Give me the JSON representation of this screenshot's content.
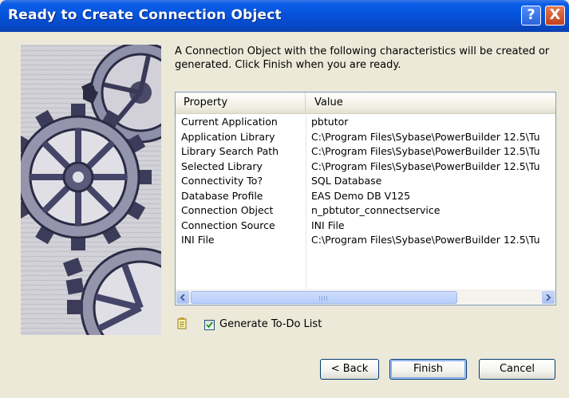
{
  "window": {
    "title": "Ready to Create Connection Object",
    "help_button": "?",
    "close_button": "X"
  },
  "description": "A Connection Object with the following characteristics will be created or generated.  Click Finish when you are ready.",
  "table": {
    "columns": [
      "Property",
      "Value"
    ],
    "rows": [
      {
        "property": "Current Application",
        "value": "pbtutor"
      },
      {
        "property": "Application Library",
        "value": "C:\\Program Files\\Sybase\\PowerBuilder 12.5\\Tu"
      },
      {
        "property": "Library Search Path",
        "value": "C:\\Program Files\\Sybase\\PowerBuilder 12.5\\Tu"
      },
      {
        "property": "Selected Library",
        "value": "C:\\Program Files\\Sybase\\PowerBuilder 12.5\\Tu"
      },
      {
        "property": "Connectivity To?",
        "value": "SQL Database"
      },
      {
        "property": "Database Profile",
        "value": "EAS Demo DB V125"
      },
      {
        "property": "Connection Object",
        "value": "n_pbtutor_connectservice"
      },
      {
        "property": "Connection Source",
        "value": "INI File"
      },
      {
        "property": "INI File",
        "value": "C:\\Program Files\\Sybase\\PowerBuilder 12.5\\Tu"
      }
    ],
    "scroll_grip": "III"
  },
  "generate_todo": {
    "label": "Generate To-Do List",
    "checked": true
  },
  "buttons": {
    "back": "< Back",
    "finish": "Finish",
    "cancel": "Cancel"
  },
  "icons": {
    "help": "help-icon",
    "close": "close-icon",
    "todo": "notepad-icon",
    "scroll_left": "chevron-left-icon",
    "scroll_right": "chevron-right-icon",
    "check": "checkmark-icon"
  },
  "colors": {
    "titlebar": "#0653dc",
    "face": "#ece9d8",
    "close": "#c1401c",
    "border": "#7f9db9"
  }
}
